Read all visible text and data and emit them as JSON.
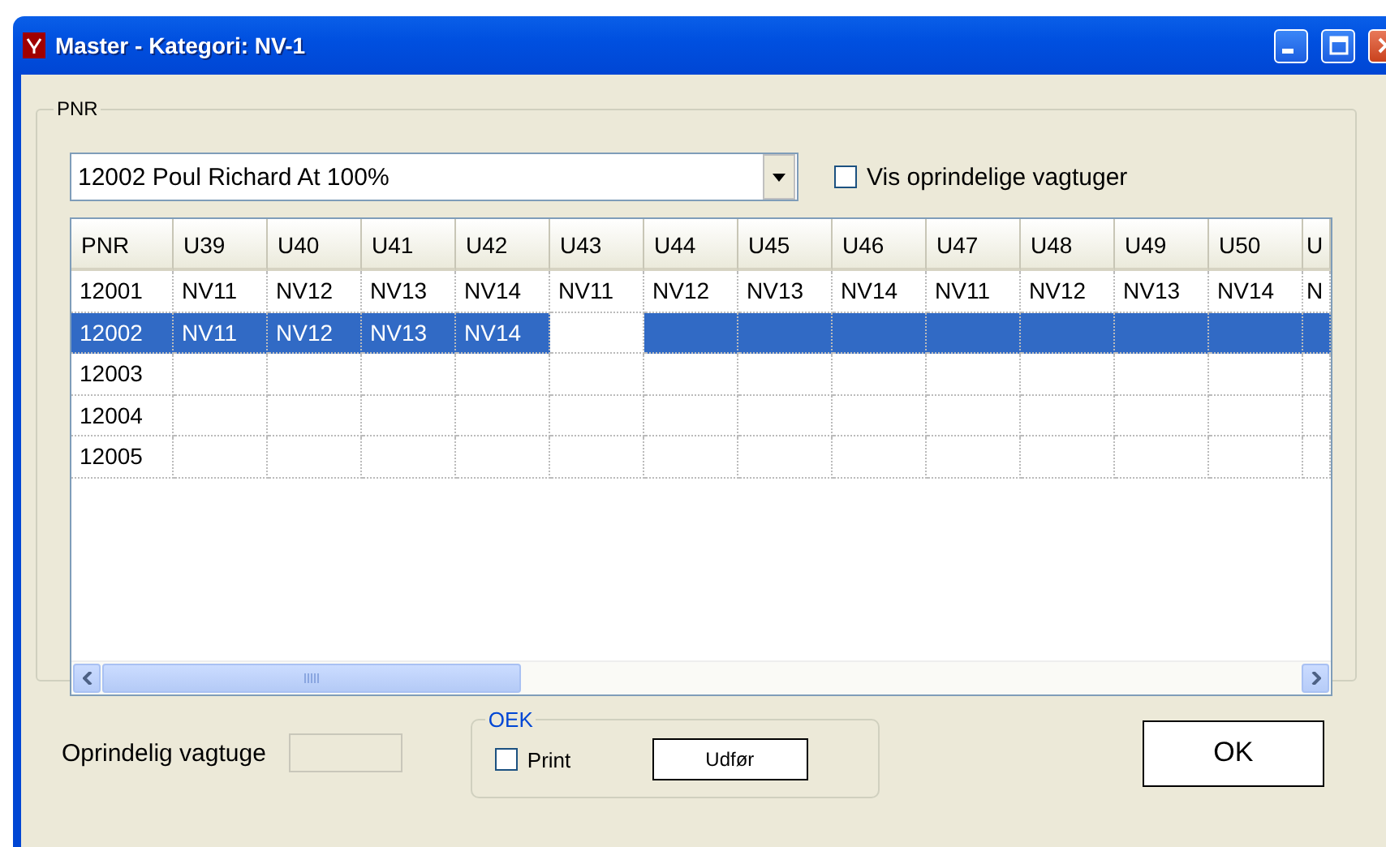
{
  "window": {
    "title": "Master - Kategori: NV-1"
  },
  "pnr_group": {
    "label": "PNR",
    "employee_select": {
      "value": "12002 Poul Richard At 100%"
    },
    "show_original": {
      "label": "Vis oprindelige vagtuger",
      "checked": false
    },
    "grid": {
      "columns": [
        "PNR",
        "U39",
        "U40",
        "U41",
        "U42",
        "U43",
        "U44",
        "U45",
        "U46",
        "U47",
        "U48",
        "U49",
        "U50",
        "U"
      ],
      "rows": [
        {
          "pnr": "12001",
          "selected": false,
          "cells": [
            "NV11",
            "NV12",
            "NV13",
            "NV14",
            "NV11",
            "NV12",
            "NV13",
            "NV14",
            "NV11",
            "NV12",
            "NV13",
            "NV14",
            "N"
          ]
        },
        {
          "pnr": "12002",
          "selected": true,
          "cells": [
            {
              "text": "NV11",
              "focused": false
            },
            {
              "text": "NV12",
              "focused": false
            },
            {
              "text": "NV13",
              "focused": false
            },
            {
              "text": "NV14",
              "focused": false
            },
            {
              "focused": true
            }
          ]
        },
        {
          "pnr": "12003",
          "selected": false
        },
        {
          "pnr": "12004",
          "selected": false
        },
        {
          "pnr": "12005",
          "selected": false
        }
      ]
    }
  },
  "original_week": {
    "label": "Oprindelig vagtuge"
  },
  "oek": {
    "label": "OEK",
    "print": {
      "label": "Print",
      "checked": false
    },
    "run_button": "Udfør"
  },
  "ok_button": "OK"
}
